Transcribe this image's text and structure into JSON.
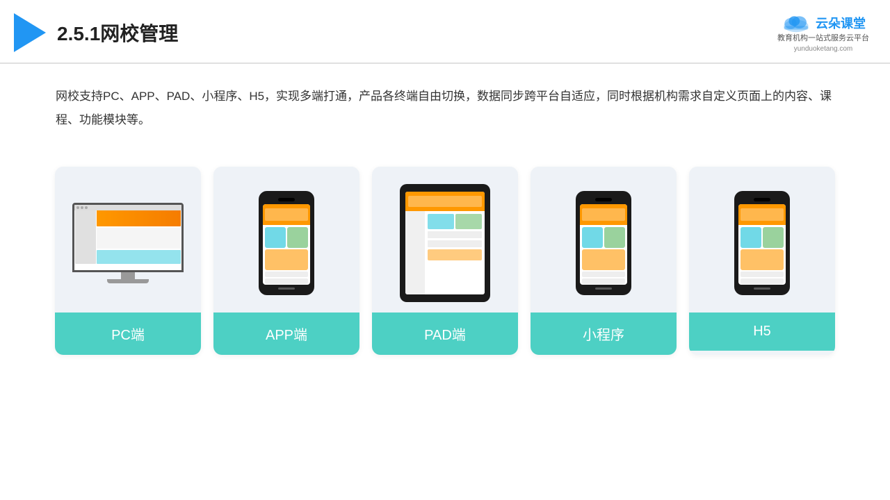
{
  "header": {
    "title": "2.5.1网校管理",
    "brand_name": "云朵课堂",
    "brand_url": "yunduoketang.com",
    "brand_sub_line1": "教育机构一站",
    "brand_sub_line2": "式服务云平台"
  },
  "description": {
    "text": "网校支持PC、APP、PAD、小程序、H5，实现多端打通，产品各终端自由切换，数据同步跨平台自适应，同时根据机构需求自定义页面上的内容、课程、功能模块等。"
  },
  "cards": [
    {
      "id": "pc",
      "label": "PC端",
      "type": "pc"
    },
    {
      "id": "app",
      "label": "APP端",
      "type": "phone"
    },
    {
      "id": "pad",
      "label": "PAD端",
      "type": "tablet"
    },
    {
      "id": "miniprogram",
      "label": "小程序",
      "type": "phone"
    },
    {
      "id": "h5",
      "label": "H5",
      "type": "phone"
    }
  ]
}
